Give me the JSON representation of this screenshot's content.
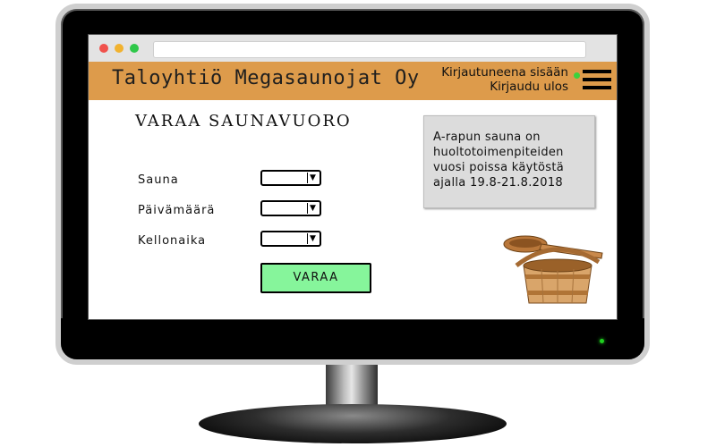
{
  "header": {
    "site_title": "Taloyhtiö Megasaunojat Oy",
    "login_status": "Kirjautuneena sisään",
    "logout_link": "Kirjaudu ulos"
  },
  "page": {
    "title": "Varaa saunavuoro"
  },
  "form": {
    "fields": [
      {
        "label": "Sauna",
        "selected": ""
      },
      {
        "label": "Päivämäärä",
        "selected": ""
      },
      {
        "label": "Kellonaika",
        "selected": ""
      }
    ],
    "submit_label": "VARAA"
  },
  "notice": {
    "text": "A-rapun sauna on\nhuoltotoimenpiteiden\nvuosi poissa käytöstä\najalla 19.8-21.8.2018"
  },
  "icons": {
    "menu": "hamburger-menu-icon",
    "image": "sauna-bucket-image"
  },
  "colors": {
    "header_bg": "#dd9b4b",
    "button_bg": "#86f59b",
    "notice_bg": "#dcdcdc",
    "status_online": "#3cd23c"
  }
}
